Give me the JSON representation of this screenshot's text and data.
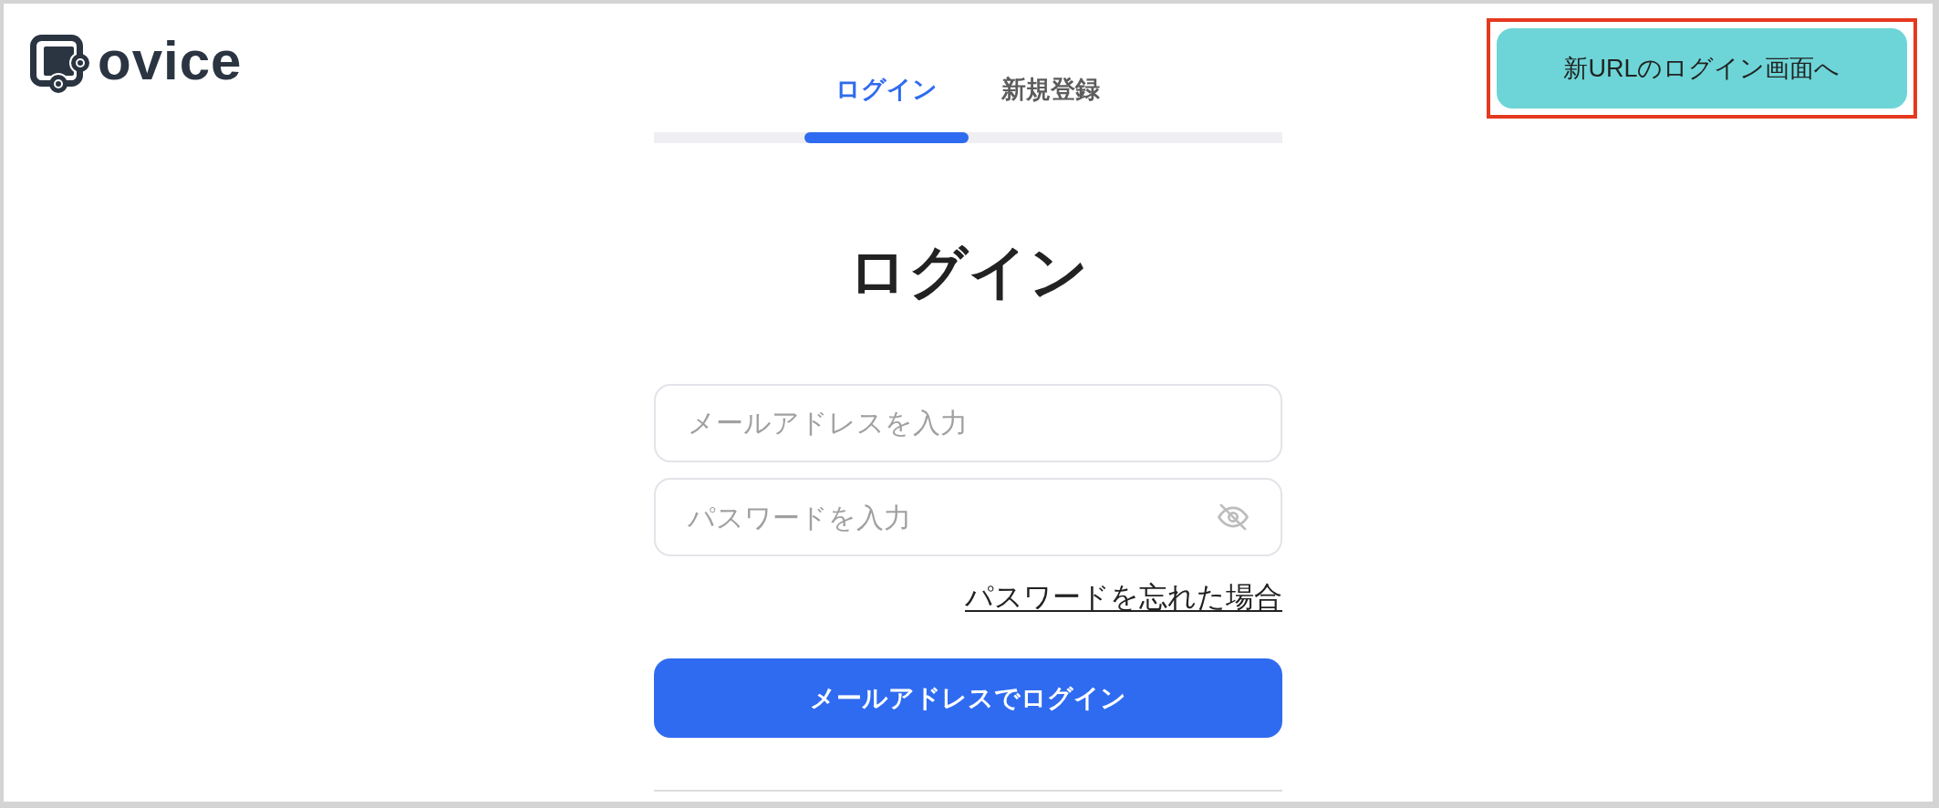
{
  "logo": {
    "text": "ovice"
  },
  "new_url_button": {
    "label": "新URLのログイン画面へ",
    "highlighted": true
  },
  "tabs": [
    {
      "label": "ログイン",
      "selected": true
    },
    {
      "label": "新規登録",
      "selected": false
    }
  ],
  "heading": "ログイン",
  "form": {
    "email_field": {
      "placeholder": "メールアドレスを入力"
    },
    "password_field": {
      "placeholder": "パスワードを入力",
      "password_visible": false
    },
    "forgot_password_link": "パスワードを忘れた場合",
    "submit_button": "メールアドレスでログイン"
  }
}
